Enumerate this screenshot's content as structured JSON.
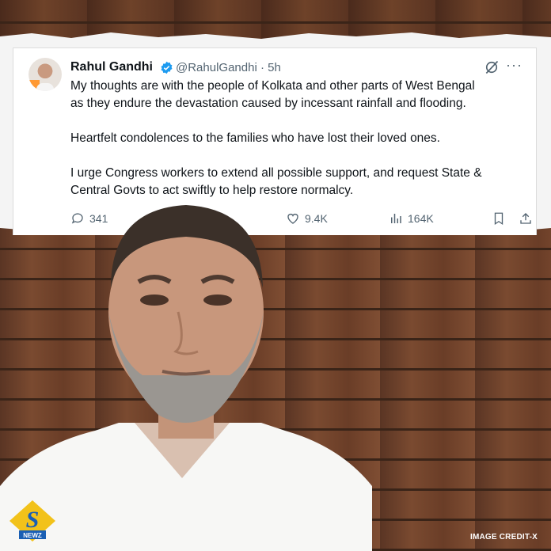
{
  "tweet": {
    "author_name": "Rahul Gandhi",
    "handle": "@RahulGandhi",
    "time": " · 5h",
    "paragraphs": [
      "My thoughts are with the people of Kolkata and other parts of West Bengal\nas they endure the devastation caused by incessant rainfall and flooding.",
      "Heartfelt condolences to the families who have lost their loved ones.",
      "I urge Congress workers to extend all possible support, and request State &\nCentral Govts to act swiftly to help restore normalcy."
    ],
    "more_glyph": "···",
    "replies": "341",
    "likes": "9.4K",
    "views": "164K"
  },
  "logo": {
    "letter": "S",
    "word": "NEWZ"
  },
  "credit": "IMAGE CREDIT-X",
  "colors": {
    "verified": "#1d9bf0",
    "text": "#0f1419",
    "muted": "#536471",
    "logo_bg": "#f2c21a",
    "logo_letter": "#1a5fb4"
  },
  "icons": [
    "verified-badge-icon",
    "grok-icon",
    "more-icon",
    "reply-icon",
    "like-icon",
    "views-icon",
    "bookmark-icon",
    "share-icon"
  ]
}
